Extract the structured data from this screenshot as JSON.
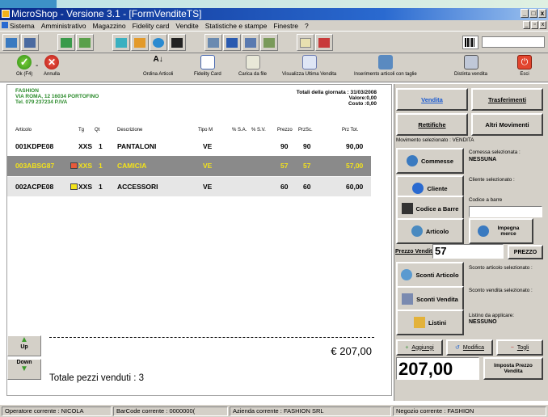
{
  "window": {
    "title": "MicroShop - Versione 3.1 - [FormVenditeTS]"
  },
  "menu": [
    "Sistema",
    "Amministrativo",
    "Magazzino",
    "Fidelity card",
    "Vendite",
    "Statistiche e stampe",
    "Finestre",
    "?"
  ],
  "actions": {
    "ok": "Ok (F4)",
    "annulla": "Annulla",
    "ordina": "Ordina Articoli",
    "fidelity": "Fidelity Card",
    "carica": "Carica da file",
    "visualizza": "Visualizza Ultima Vendita",
    "inserimento": "Inserimento articoli con taglie",
    "distinta": "Distinta vendita",
    "esci": "Esci"
  },
  "shop": {
    "name": "FASHION",
    "address": "VIA ROMA, 12 16034 PORTOFINO",
    "tel": "Tel. 079 237234  P.IVA"
  },
  "totals": {
    "title": "Totali della giornata : 31/03/2008",
    "valore": "Valore:0,00",
    "costo": "Costo :0,00"
  },
  "columns": {
    "articolo": "Articolo",
    "tg": "Tg",
    "qt": "Qt",
    "descrizione": "Descrizione",
    "tipo": "Tipo M",
    "sa": "% S.A.",
    "sv": "% S.V.",
    "prezzo": "Prezzo",
    "przsc": "PrzSc.",
    "prztot": "Prz Tot."
  },
  "rows": [
    {
      "articolo": "001KDPE08",
      "tg": "XXS",
      "qt": "1",
      "descrizione": "PANTALONI",
      "tipo": "VE",
      "prezzo": "90",
      "przsc": "90",
      "tot": "90,00",
      "swatch": ""
    },
    {
      "articolo": "003ABSG87",
      "tg": "XXS",
      "qt": "1",
      "descrizione": "CAMICIA",
      "tipo": "VE",
      "prezzo": "57",
      "przsc": "57",
      "tot": "57,00",
      "swatch": "#e8593a"
    },
    {
      "articolo": "002ACPE08",
      "tg": "XXS",
      "qt": "1",
      "descrizione": "ACCESSORI",
      "tipo": "VE",
      "prezzo": "60",
      "przsc": "60",
      "tot": "60,00",
      "swatch": "#f3e31a"
    }
  ],
  "nav": {
    "up": "Up",
    "down": "Down"
  },
  "footer": {
    "total": "€ 207,00",
    "pezzi": "Totale pezzi venduti : 3"
  },
  "panel": {
    "vendita": "Vendita",
    "trasferimenti": "Trasferimenti",
    "rettifiche": "Rettifiche",
    "altri": "Altri Movimenti",
    "movimento": "Movimento selezionato : VENDITA",
    "commesse": "Commesse",
    "commessa_label": "Comessa selezionata :",
    "commessa_value": "NESSUNA",
    "cliente": "Cliente",
    "cliente_label": "Cliente selezionato :",
    "codice": "Codice a Barre",
    "codice_label": "Codice a barre",
    "articolo": "Articolo",
    "impegna": "Impegna merce",
    "prezzo_label": "Prezzo Vendita",
    "prezzo_value": "57",
    "prezzo_btn": "PREZZO",
    "sconti_art": "Sconti Articolo",
    "sconto_art_label": "Sconto articolo selezionato :",
    "sconti_vend": "Sconti Vendita",
    "sconto_vend_label": "Sconto vendita selezionato :",
    "listini": "Listini",
    "listino_label": "Listino da applicare:",
    "listino_value": "NESSUNO",
    "aggiungi": "Aggiungi",
    "modifica": "Modifica",
    "togli": "Togli",
    "big_total": "207,00",
    "imposta": "Imposta Prezzo Vendita"
  },
  "status": {
    "operatore": "Operatore corrente : NICOLA",
    "barcode": "BarCode corrente : 0000000(",
    "azienda": "Azienda corrente : FASHION SRL",
    "negozio": "Negozio corrente : FASHION"
  }
}
